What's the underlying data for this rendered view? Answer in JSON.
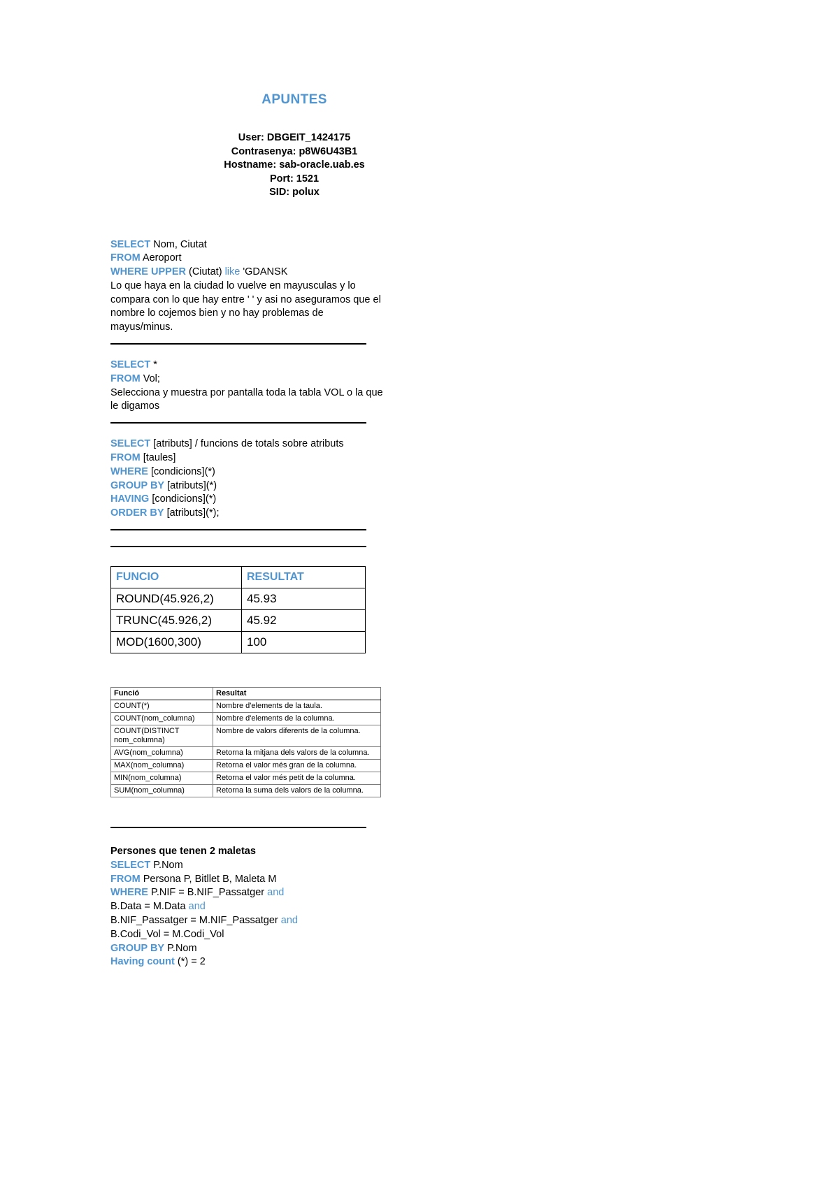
{
  "document": {
    "title": "APUNTES",
    "accent_color": "#4f95d1",
    "credentials": {
      "user": "User: DBGEIT_1424175",
      "password": "Contrasenya: p8W6U43B1",
      "hostname": "Hostname: sab-oracle.uab.es",
      "port": "Port: 1521",
      "sid": "SID: polux"
    },
    "block1": {
      "l1_kw": "SELECT",
      "l1_rest": " Nom, Ciutat",
      "l2_kw": "FROM",
      "l2_rest": " Aeroport",
      "l3_kw": "WHERE UPPER",
      "l3_mid": " (Ciutat) ",
      "l3_kw2": "like",
      "l3_rest": " 'GDANSK",
      "note1": "Lo que haya en la ciudad lo vuelve en mayusculas y lo",
      "note2": "compara con lo que hay entre ' ' y asi no aseguramos que el",
      "note3": "nombre lo cojemos bien y no hay problemas de",
      "note4": "mayus/minus."
    },
    "block2": {
      "l1_kw": "SELECT",
      "l1_rest": " *",
      "l2_kw": "FROM",
      "l2_rest": " Vol;",
      "note1": "Selecciona y muestra por pantalla toda la tabla VOL o la que",
      "note2": "le digamos"
    },
    "block3": {
      "l1_kw": "SELECT",
      "l1_rest": " [atributs] / funcions de totals sobre atributs",
      "l2_kw": "FROM",
      "l2_rest": " [taules]",
      "l3_kw": "WHERE",
      "l3_rest": " [condicions](*)",
      "l4_kw": "GROUP BY",
      "l4_rest": " [atributs](*)",
      "l5_kw": "HAVING",
      "l5_rest": " [condicions](*)",
      "l6_kw": "ORDER BY",
      "l6_rest": " [atributs](*);"
    },
    "big_table": {
      "headers": [
        "FUNCIO",
        "RESULTAT"
      ],
      "rows": [
        [
          "ROUND(45.926,2)",
          "45.93"
        ],
        [
          "TRUNC(45.926,2)",
          "45.92"
        ],
        [
          "MOD(1600,300)",
          "100"
        ]
      ]
    },
    "small_table": {
      "headers": [
        "Funció",
        "Resultat"
      ],
      "rows": [
        [
          "COUNT(*)",
          "Nombre d'elements de la taula."
        ],
        [
          "COUNT(nom_columna)",
          "Nombre d'elements de la columna."
        ],
        [
          "COUNT(DISTINCT nom_columna)",
          "Nombre de valors diferents de la columna."
        ],
        [
          "AVG(nom_columna)",
          "Retorna la mitjana dels valors de la columna."
        ],
        [
          "MAX(nom_columna)",
          "Retorna el valor més gran de la columna."
        ],
        [
          "MIN(nom_columna)",
          "Retorna el valor més petit de la columna."
        ],
        [
          "SUM(nom_columna)",
          "Retorna la suma dels valors de la columna."
        ]
      ]
    },
    "block4": {
      "heading": "Persones que tenen 2 maletas",
      "l1_kw": "SELECT",
      "l1_rest": " P.Nom",
      "l2_kw": "FROM",
      "l2_rest": " Persona P, Bitllet B, Maleta M",
      "l3_kw": "WHERE",
      "l3_mid": " P.NIF = B.NIF_Passatger ",
      "l3_kw2": "and",
      "l4_pre": "B.Data = M.Data ",
      "l4_kw": "and",
      "l5_pre": "B.NIF_Passatger = M.NIF_Passatger ",
      "l5_kw": "and",
      "l6_text": "B.Codi_Vol = M.Codi_Vol",
      "l7_kw": "GROUP BY",
      "l7_rest": " P.Nom",
      "l8_kw": "Having count",
      "l8_rest": " (*) = 2"
    }
  }
}
